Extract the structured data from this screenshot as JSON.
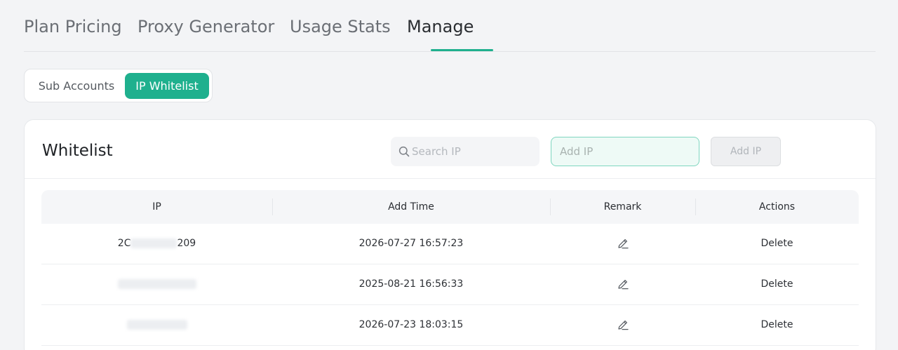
{
  "tabs": [
    {
      "label": "Plan Pricing"
    },
    {
      "label": "Proxy Generator"
    },
    {
      "label": "Usage Stats"
    },
    {
      "label": "Manage"
    }
  ],
  "active_tab": "Manage",
  "segment": {
    "sub_accounts": "Sub Accounts",
    "ip_whitelist": "IP Whitelist",
    "active": "IP Whitelist"
  },
  "card": {
    "title": "Whitelist",
    "search_placeholder": "Search IP",
    "add_placeholder": "Add IP",
    "add_button": "Add IP"
  },
  "table": {
    "headers": {
      "ip": "IP",
      "add_time": "Add Time",
      "remark": "Remark",
      "actions": "Actions"
    },
    "rows": [
      {
        "ip_prefix": "2C",
        "ip_suffix": "209",
        "add_time": "2026-07-27 16:57:23",
        "action": "Delete"
      },
      {
        "ip_prefix": "",
        "ip_suffix": "",
        "add_time": "2025-08-21 16:56:33",
        "action": "Delete"
      },
      {
        "ip_prefix": "",
        "ip_suffix": "",
        "add_time": "2026-07-23 18:03:15",
        "action": "Delete"
      }
    ]
  },
  "colors": {
    "accent": "#1fb08e"
  }
}
